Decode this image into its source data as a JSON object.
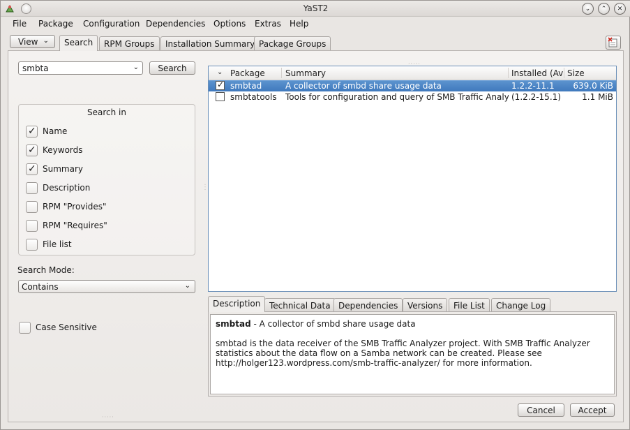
{
  "window": {
    "title": "YaST2"
  },
  "menubar": {
    "items": [
      "File",
      "Package",
      "Configuration",
      "Dependencies",
      "Options",
      "Extras",
      "Help"
    ]
  },
  "toolbar": {
    "view_label": "View",
    "tabs": [
      "Search",
      "RPM Groups",
      "Installation Summary",
      "Package Groups"
    ],
    "active_tab": "Search"
  },
  "search": {
    "query": "smbta",
    "button_label": "Search",
    "search_in_title": "Search in",
    "options": [
      {
        "label": "Name",
        "checked": true
      },
      {
        "label": "Keywords",
        "checked": true
      },
      {
        "label": "Summary",
        "checked": true
      },
      {
        "label": "Description",
        "checked": false
      },
      {
        "label": "RPM \"Provides\"",
        "checked": false
      },
      {
        "label": "RPM \"Requires\"",
        "checked": false
      },
      {
        "label": "File list",
        "checked": false
      }
    ],
    "mode_label": "Search Mode:",
    "mode_value": "Contains",
    "case_sensitive_label": "Case Sensitive",
    "case_sensitive_checked": false
  },
  "packages": {
    "columns": [
      "Package",
      "Summary",
      "Installed (Ava",
      "Size"
    ],
    "rows": [
      {
        "name": "smbtad",
        "summary": "A collector of smbd share usage data",
        "installed": "1.2.2-11.1",
        "size": "639.0 KiB",
        "checked": true,
        "selected": true
      },
      {
        "name": "smbtatools",
        "summary": "Tools for configuration and query of SMB Traffic Analyzer",
        "installed": "(1.2.2-15.1)",
        "size": "1.1 MiB",
        "checked": false,
        "selected": false
      }
    ]
  },
  "details": {
    "tabs": [
      "Description",
      "Technical Data",
      "Dependencies",
      "Versions",
      "File List",
      "Change Log"
    ],
    "active_tab": "Description",
    "pkg_name": "smbtad",
    "pkg_summary": " - A collector of smbd share usage data",
    "body": "smbtad is the data receiver of the SMB Traffic Analyzer project. With SMB Traffic Analyzer statistics about the data flow on a Samba network can be created. Please see http://holger123.wordpress.com/smb-traffic-analyzer/ for more information."
  },
  "footer": {
    "cancel_label": "Cancel",
    "accept_label": "Accept"
  }
}
